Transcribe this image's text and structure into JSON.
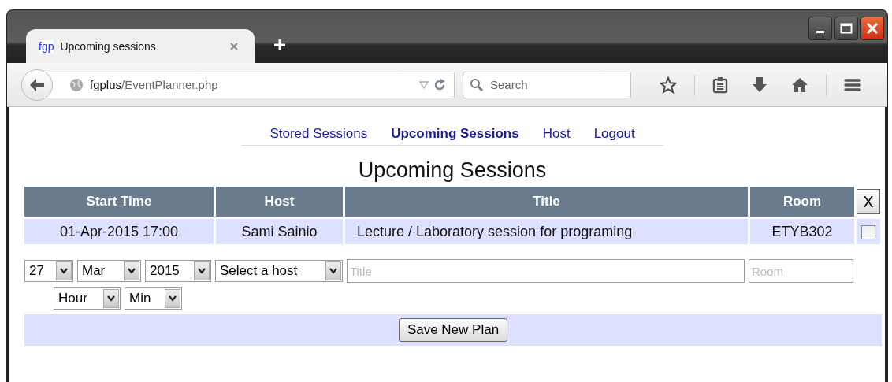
{
  "browser_tab": {
    "favicon": "fgp",
    "title": "Upcoming sessions"
  },
  "address_bar": {
    "host": "fgplus",
    "path": "/EventPlanner.php"
  },
  "search": {
    "placeholder": "Search"
  },
  "nav": [
    {
      "label": "Stored Sessions",
      "selected": false
    },
    {
      "label": "Upcoming Sessions",
      "selected": true
    },
    {
      "label": "Host",
      "selected": false
    },
    {
      "label": "Logout",
      "selected": false
    }
  ],
  "heading": "Upcoming Sessions",
  "table": {
    "columns": [
      "Start Time",
      "Host",
      "Title",
      "Room"
    ],
    "delete_button": "X",
    "rows": [
      {
        "start_time": "01-Apr-2015 17:00",
        "host": "Sami Sainio",
        "title": "Lecture / Laboratory session for programing",
        "room": "ETYB302",
        "checked": false
      }
    ]
  },
  "form": {
    "day": "27",
    "month": "Mar",
    "year": "2015",
    "host": "Select a host",
    "title_placeholder": "Title",
    "room_placeholder": "Room",
    "hour": "Hour",
    "minute": "Min",
    "save_button": "Save New Plan"
  }
}
